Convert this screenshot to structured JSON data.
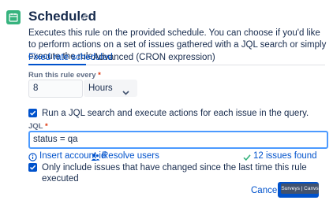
{
  "header": {
    "title": "Scheduled",
    "icon": "calendar-icon",
    "edit_icon": "pencil-icon"
  },
  "description": "Executes this rule on the provided schedule. You can choose if you'd like to perform actions on a set of issues gathered with a JQL search or simply execute the rule.",
  "tabs": [
    {
      "label": "Fixed rate scheduled",
      "active": true
    },
    {
      "label": "Advanced (CRON expression)",
      "active": false
    }
  ],
  "schedule": {
    "label": "Run this rule every",
    "required_mark": "*",
    "value": "8",
    "unit": "Hours"
  },
  "jql_checkbox": {
    "checked": true,
    "label": "Run a JQL search and execute actions for each issue in the query."
  },
  "jql": {
    "label": "JQL",
    "required_mark": "*",
    "value": "status = qa"
  },
  "links": {
    "insert_account": "Insert account id",
    "resolve_users": "Resolve users",
    "issues_found": "12 issues found"
  },
  "changed_checkbox": {
    "checked": true,
    "label": "Only include issues that have changed since the last time this rule executed"
  },
  "footer": {
    "cancel_label": "Cancel",
    "overlay_badge": "Surveys | Canvs"
  },
  "colors": {
    "accent": "#0052cc",
    "calendar_green": "#36b37e",
    "success_green": "#36b37e",
    "required_red": "#de350b",
    "focus_border": "#4c9aff"
  }
}
